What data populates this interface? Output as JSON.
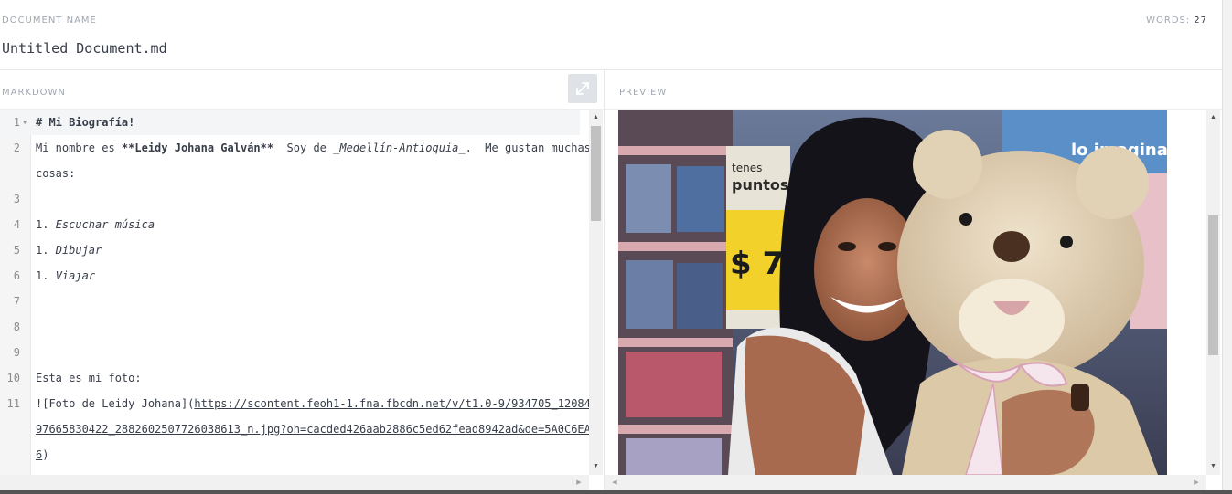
{
  "document": {
    "label": "DOCUMENT NAME",
    "name": "Untitled Document.md",
    "words_label": "WORDS:",
    "words_count": "27"
  },
  "panes": {
    "markdown_title": "MARKDOWN",
    "preview_title": "PREVIEW",
    "expand_icon": "expand-arrows-icon"
  },
  "editor": {
    "lines": [
      {
        "num": "1",
        "text": "# Mi Biografía!"
      },
      {
        "num": "2",
        "text_prefix": "Mi nombre es ",
        "text_bold": "**Leidy Johana Galván**",
        "text_mid": "  Soy de ",
        "text_italic": "_Medellín-Antioquia_",
        "text_suffix": ".  Me gustan muchas"
      },
      {
        "text": "cosas:"
      },
      {
        "num": "3",
        "text": ""
      },
      {
        "num": "4",
        "text_prefix": "1. ",
        "text_italic": "Escuchar música"
      },
      {
        "num": "5",
        "text_prefix": "1. ",
        "text_italic": "Dibujar"
      },
      {
        "num": "6",
        "text_prefix": "1. ",
        "text_italic": "Viajar"
      },
      {
        "num": "7",
        "text": ""
      },
      {
        "num": "8",
        "text": ""
      },
      {
        "num": "9",
        "text": ""
      },
      {
        "num": "10",
        "text": "Esta es mi foto:"
      },
      {
        "num": "11",
        "text_prefix": "![Foto de Leidy Johana](",
        "text_link": "https://scontent.feoh1-1.fna.fbcdn.net/v/t1.0-9/934705_12084"
      },
      {
        "text_link": "97665830422_2882602507726038613_n.jpg?oh=cacded426aab2886c5ed62fead8942ad&oe=5A0C6EA"
      },
      {
        "text_link": "6",
        "text_suffix": ")"
      }
    ]
  },
  "preview": {
    "image_alt": "Foto de Leidy Johana",
    "sign_text_1": "tenes",
    "sign_text_2": "puntos",
    "price_text": "$ 7",
    "banner_text": "lo imagina"
  },
  "colors": {
    "accent": "#373d49",
    "muted": "#a0a6b0"
  }
}
